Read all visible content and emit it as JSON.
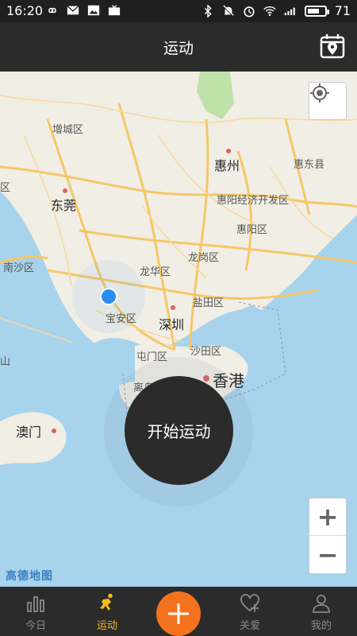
{
  "status_bar": {
    "time": "16:20",
    "battery_level": "71",
    "battery_fraction": 0.71
  },
  "header": {
    "title": "运动",
    "calendar_icon": "calendar-location-icon"
  },
  "map": {
    "labels": {
      "zengcheng": "增城区",
      "huizhou": "惠州",
      "huidong": "惠东县",
      "dongguan": "东莞",
      "huiyang_econ": "惠阳经济开发区",
      "huiyang": "惠阳区",
      "nansha": "南沙区",
      "longgang": "龙岗区",
      "longhua": "龙华区",
      "yantian": "盐田区",
      "baoan": "宝安区",
      "shenzhen": "深圳",
      "tuenmun": "屯门区",
      "shatin": "沙田区",
      "islands": "离岛区",
      "hongkong": "香港",
      "macau": "澳门",
      "shan": "山",
      "qu": "区"
    },
    "provider_logo": "高德地图",
    "zoom_in_label": "+",
    "zoom_out_label": "−",
    "locate_icon": "locate-crosshair-icon",
    "colors": {
      "water": "#a8d3ec",
      "land": "#f1eee6",
      "road": "#f6c768",
      "green": "#bfe2a8",
      "location_dot": "#2a8df0"
    }
  },
  "start_button": {
    "label": "开始运动"
  },
  "tab_bar": {
    "tabs": [
      {
        "label": "今日",
        "icon": "bar-chart-icon",
        "active": false
      },
      {
        "label": "运动",
        "icon": "running-person-icon",
        "active": true
      },
      {
        "label": "",
        "icon": "plus-icon",
        "active": false
      },
      {
        "label": "关爱",
        "icon": "heart-plus-icon",
        "active": false
      },
      {
        "label": "我的",
        "icon": "person-icon",
        "active": false
      }
    ],
    "active_color": "#f5b81e",
    "add_color": "#f4721e"
  }
}
